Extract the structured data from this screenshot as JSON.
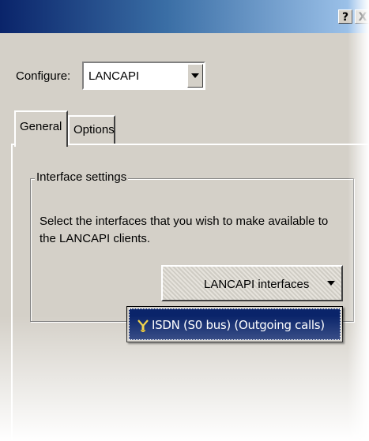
{
  "window": {
    "help_label": "?",
    "close_label": "X"
  },
  "configure": {
    "label": "Configure:",
    "selected": "LANCAPI"
  },
  "tabs": [
    {
      "label": "General",
      "active": true
    },
    {
      "label": "Options",
      "active": false
    }
  ],
  "interface_settings": {
    "legend": "Interface settings",
    "description": "Select the interfaces that you wish to make available to the LANCAPI clients.",
    "dropdown_label": "LANCAPI interfaces",
    "options": [
      {
        "label": "ISDN (S0 bus) (Outgoing calls)",
        "selected": true,
        "icon": "isdn-plug-icon"
      }
    ]
  },
  "colors": {
    "title_gradient_start": "#0a246a",
    "title_gradient_end": "#a6caf0",
    "selection": "#0a246a",
    "face": "#d4d0c8"
  }
}
